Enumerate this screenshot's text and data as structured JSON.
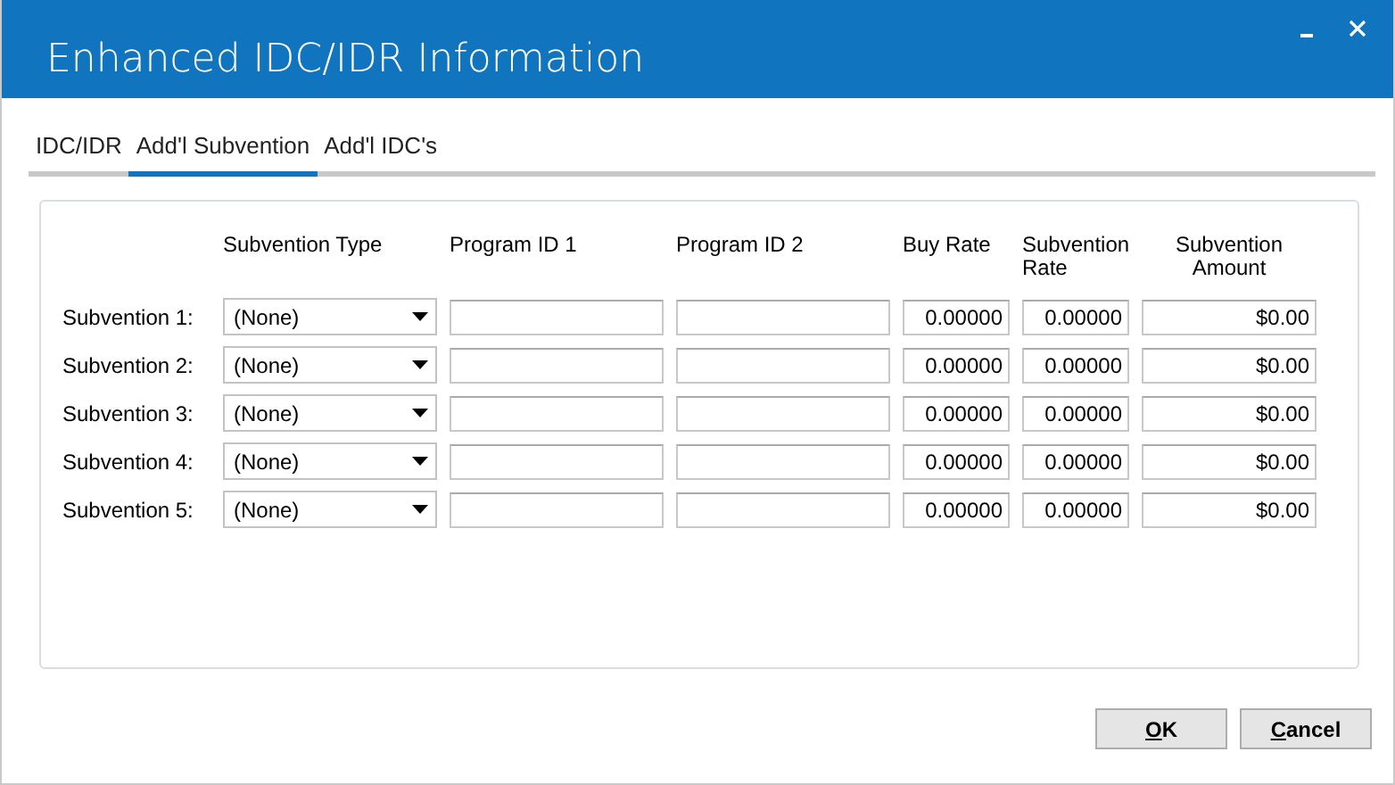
{
  "window": {
    "title": "Enhanced IDC/IDR Information"
  },
  "tabs": [
    {
      "label": "IDC/IDR",
      "selected": false
    },
    {
      "label": "Add'l Subvention",
      "selected": true
    },
    {
      "label": "Add'l IDC's",
      "selected": false
    }
  ],
  "table": {
    "columns": [
      "Subvention Type",
      "Program ID 1",
      "Program ID 2",
      "Buy Rate",
      "Subvention Rate",
      "Subvention Amount"
    ],
    "rows": [
      {
        "label": "Subvention 1:",
        "subvention_type": "(None)",
        "buy_rate": "0.00000",
        "subvention_rate": "0.00000",
        "subvention_amount": "$0.00"
      },
      {
        "label": "Subvention 2:",
        "subvention_type": "(None)",
        "buy_rate": "0.00000",
        "subvention_rate": "0.00000",
        "subvention_amount": "$0.00"
      },
      {
        "label": "Subvention 3:",
        "subvention_type": "(None)",
        "buy_rate": "0.00000",
        "subvention_rate": "0.00000",
        "subvention_amount": "$0.00"
      },
      {
        "label": "Subvention 4:",
        "subvention_type": "(None)",
        "buy_rate": "0.00000",
        "subvention_rate": "0.00000",
        "subvention_amount": "$0.00"
      },
      {
        "label": "Subvention 5:",
        "subvention_type": "(None)",
        "buy_rate": "0.00000",
        "subvention_rate": "0.00000",
        "subvention_amount": "$0.00"
      }
    ]
  },
  "buttons": [
    "OK",
    "Cancel"
  ]
}
